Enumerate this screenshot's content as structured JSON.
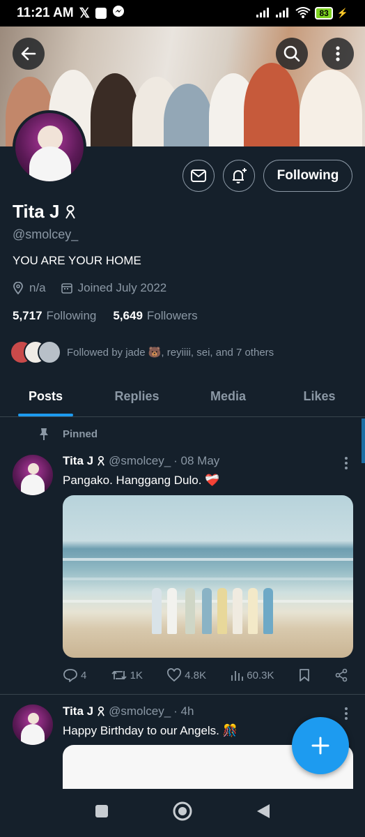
{
  "status_bar": {
    "time": "11:21 AM",
    "battery": "83"
  },
  "profile": {
    "display_name": "Tita J",
    "handle": "@smolcey_",
    "bio": "YOU ARE YOUR HOME",
    "location": "n/a",
    "joined": "Joined July 2022",
    "following_count": "5,717",
    "following_label": "Following",
    "followers_count": "5,649",
    "followers_label": "Followers",
    "followed_by": "Followed by jade 🐻, reyiiii, sei, and 7 others",
    "follow_button": "Following"
  },
  "tabs": [
    {
      "label": "Posts",
      "active": true
    },
    {
      "label": "Replies",
      "active": false
    },
    {
      "label": "Media",
      "active": false
    },
    {
      "label": "Likes",
      "active": false
    }
  ],
  "posts": [
    {
      "pinned_label": "Pinned",
      "name": "Tita J",
      "handle": "@smolcey_",
      "time": "· 08 May",
      "text": "Pangako. Hanggang Dulo. ❤️‍🩹",
      "replies": "4",
      "reposts": "1K",
      "likes": "4.8K",
      "views": "60.3K"
    },
    {
      "name": "Tita J",
      "handle": "@smolcey_",
      "time": "· 4h",
      "text": "Happy Birthday to our Angels. 🎊"
    }
  ],
  "colors": {
    "background": "#15202b",
    "accent": "#1d9bf0",
    "muted": "#8b98a5",
    "border": "#38444d"
  }
}
